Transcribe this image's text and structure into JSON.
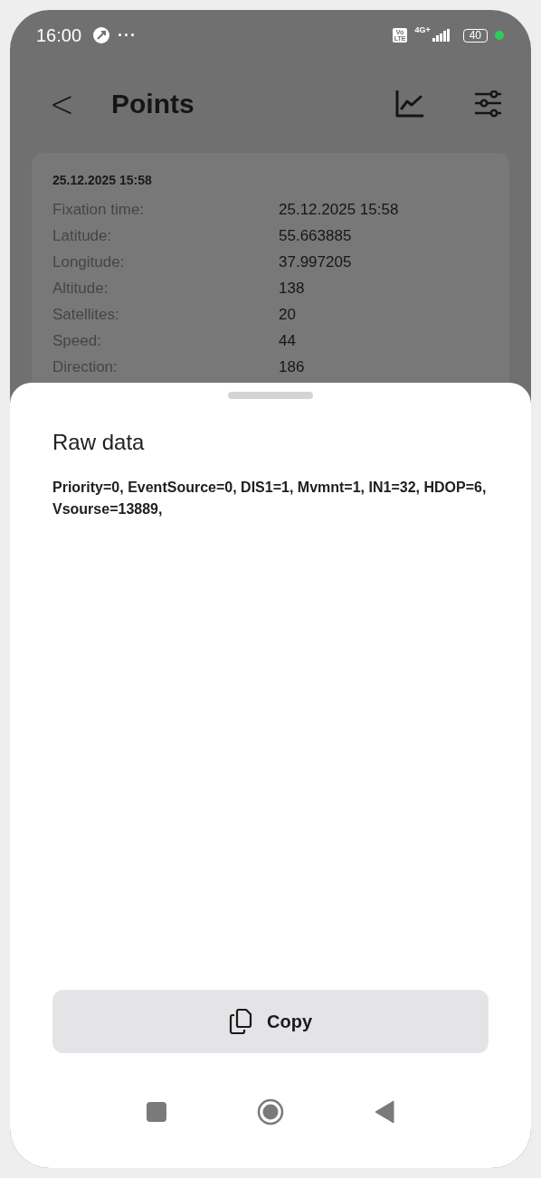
{
  "status_bar": {
    "time": "16:00",
    "more": "···",
    "volte": [
      "Vo",
      "LTE"
    ],
    "network": "4G+",
    "battery": "40"
  },
  "header": {
    "back": "<",
    "title": "Points"
  },
  "card": {
    "title": "25.12.2025 15:58",
    "rows": [
      {
        "label": "Fixation time:",
        "value": "25.12.2025 15:58"
      },
      {
        "label": "Latitude:",
        "value": "55.663885"
      },
      {
        "label": "Longitude:",
        "value": "37.997205"
      },
      {
        "label": "Altitude:",
        "value": "138"
      },
      {
        "label": "Satellites:",
        "value": "20"
      },
      {
        "label": "Speed:",
        "value": "44"
      },
      {
        "label": "Direction:",
        "value": "186"
      }
    ]
  },
  "sheet": {
    "title": "Raw data",
    "text": "Priority=0, EventSource=0, DIS1=1, Mvmnt=1, IN1=32, HDOP=6, Vsourse=13889,",
    "button": "Copy"
  }
}
